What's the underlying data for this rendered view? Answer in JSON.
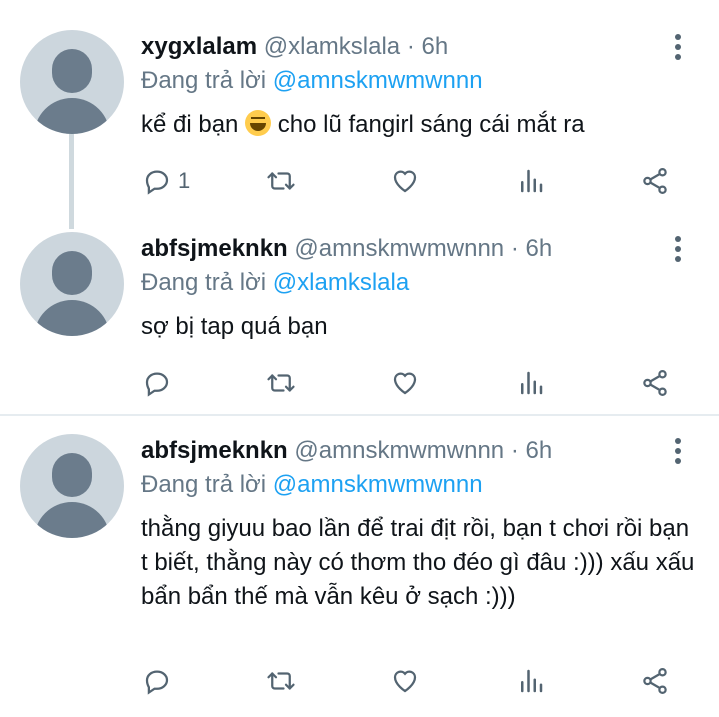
{
  "tweets": [
    {
      "name": "xygxlalam",
      "handle": "@xlamkslala",
      "time": "· 6h",
      "replying_prefix": "Đang trả lời ",
      "replying_to": "@amnskmwmwnnn",
      "text_before_emoji": "kể đi bạn ",
      "emoji": "rolling-on-floor-laughing",
      "text_after_emoji": " cho lũ fangirl sáng cái mắt ra",
      "reply_count": "1"
    },
    {
      "name": "abfsjmeknkn",
      "handle": "@amnskmwmwnnn",
      "time": "· 6h",
      "replying_prefix": "Đang trả lời ",
      "replying_to": "@xlamkslala",
      "text": "sợ bị tap quá bạn",
      "reply_count": ""
    },
    {
      "name": "abfsjmeknkn",
      "handle": "@amnskmwmwnnn",
      "time": "· 6h",
      "replying_prefix": "Đang trả lời ",
      "replying_to": "@amnskmwmwnnn",
      "text": "thằng giyuu bao lần để trai địt rồi, bạn t chơi rồi bạn t biết, thằng này có thơm tho đéo gì đâu :))) xấu xấu bẩn bẩn thế mà vẫn kêu ở sạch :)))",
      "reply_count": ""
    }
  ],
  "colors": {
    "link": "#1da1f2",
    "secondary": "#657786",
    "icon": "#536471",
    "divider": "#e6ecf0"
  },
  "icons": [
    "reply-icon",
    "retweet-icon",
    "like-icon",
    "analytics-icon",
    "share-icon",
    "more-icon"
  ]
}
